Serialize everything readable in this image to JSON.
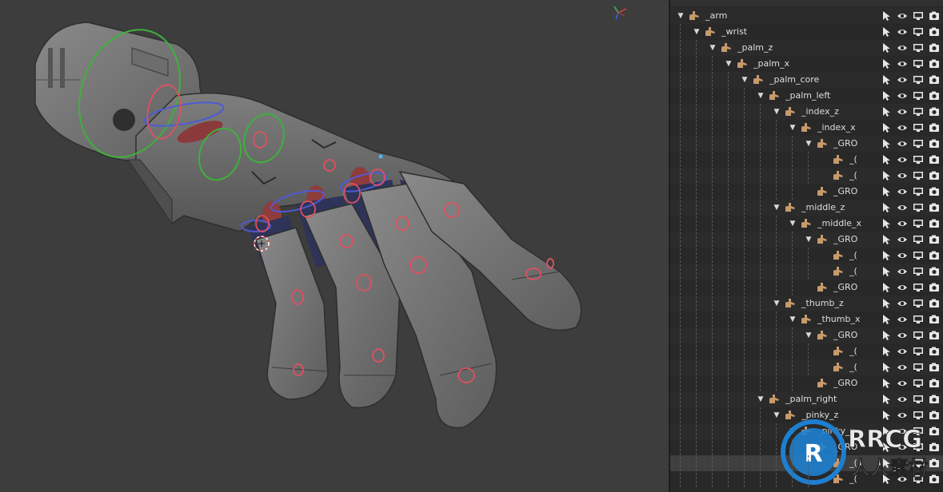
{
  "outliner": {
    "rows": [
      {
        "label": "_arm",
        "indent": 0,
        "kind": "bone",
        "disclosure": "open"
      },
      {
        "label": "_wrist",
        "indent": 1,
        "kind": "bone",
        "disclosure": "open"
      },
      {
        "label": "_palm_z",
        "indent": 2,
        "kind": "bone",
        "disclosure": "open"
      },
      {
        "label": "_palm_x",
        "indent": 3,
        "kind": "bone",
        "disclosure": "open"
      },
      {
        "label": "_palm_core",
        "indent": 4,
        "kind": "bone",
        "disclosure": "open"
      },
      {
        "label": "_palm_left",
        "indent": 5,
        "kind": "bone",
        "disclosure": "open"
      },
      {
        "label": "_index_z",
        "indent": 6,
        "kind": "bone",
        "disclosure": "open"
      },
      {
        "label": "_index_x",
        "indent": 7,
        "kind": "bone",
        "disclosure": "open"
      },
      {
        "label": "_GRO",
        "indent": 8,
        "kind": "bone",
        "disclosure": "open"
      },
      {
        "label": "_(",
        "indent": 9,
        "kind": "bone",
        "disclosure": "none"
      },
      {
        "label": "_(",
        "indent": 9,
        "kind": "bone",
        "disclosure": "none"
      },
      {
        "label": "_GRO",
        "indent": 8,
        "kind": "bone",
        "disclosure": "none"
      },
      {
        "label": "_middle_z",
        "indent": 6,
        "kind": "bone",
        "disclosure": "open"
      },
      {
        "label": "_middle_x",
        "indent": 7,
        "kind": "bone",
        "disclosure": "open"
      },
      {
        "label": "_GRO",
        "indent": 8,
        "kind": "bone",
        "disclosure": "open"
      },
      {
        "label": "_(",
        "indent": 9,
        "kind": "bone",
        "disclosure": "none"
      },
      {
        "label": "_(",
        "indent": 9,
        "kind": "bone",
        "disclosure": "none"
      },
      {
        "label": "_GRO",
        "indent": 8,
        "kind": "bone",
        "disclosure": "none"
      },
      {
        "label": "_thumb_z",
        "indent": 6,
        "kind": "bone",
        "disclosure": "open"
      },
      {
        "label": "_thumb_x",
        "indent": 7,
        "kind": "bone",
        "disclosure": "open"
      },
      {
        "label": "_GRO",
        "indent": 8,
        "kind": "bone",
        "disclosure": "open"
      },
      {
        "label": "_(",
        "indent": 9,
        "kind": "bone",
        "disclosure": "none"
      },
      {
        "label": "_(",
        "indent": 9,
        "kind": "bone",
        "disclosure": "none"
      },
      {
        "label": "_GRO",
        "indent": 8,
        "kind": "bone",
        "disclosure": "none"
      },
      {
        "label": "_palm_right",
        "indent": 5,
        "kind": "bone",
        "disclosure": "open"
      },
      {
        "label": "_pinky_z",
        "indent": 6,
        "kind": "bone",
        "disclosure": "open"
      },
      {
        "label": "_pinky_x",
        "indent": 7,
        "kind": "bone",
        "disclosure": "open"
      },
      {
        "label": "_GRO",
        "indent": 8,
        "kind": "bone",
        "disclosure": "open"
      },
      {
        "label": "_(",
        "indent": 9,
        "kind": "bone",
        "disclosure": "none",
        "highlight": true
      },
      {
        "label": "_(",
        "indent": 9,
        "kind": "bone",
        "disclosure": "none"
      }
    ],
    "row_icons": [
      "select-arrow-icon",
      "eye-icon",
      "monitor-icon",
      "camera-icon"
    ]
  },
  "watermark": {
    "brand": "RRCG",
    "subtitle": "人人素材"
  },
  "colors": {
    "viewport_bg": "#3d3d3d",
    "outliner_bg": "#282828",
    "bone_icon": "#c79a6b",
    "control_green": "#3fb13b",
    "control_red": "#e05060",
    "control_blue": "#4c5bd6"
  }
}
